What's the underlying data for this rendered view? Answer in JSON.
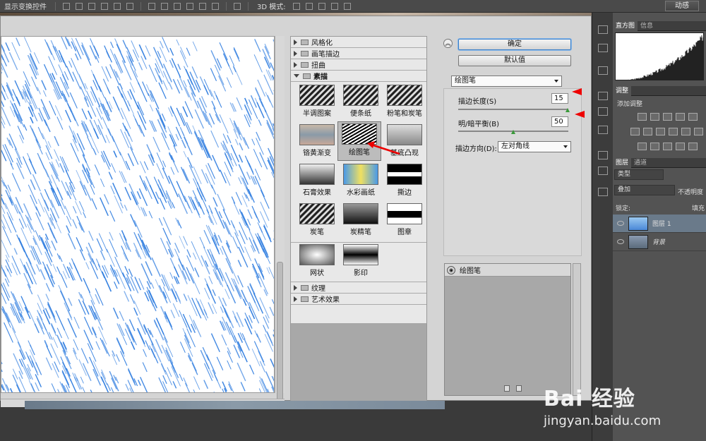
{
  "toolbar": {
    "title": "显示变换控件",
    "mode3d": "3D 模式:",
    "right_button": "动感"
  },
  "filters": {
    "categories_top": [
      "风格化",
      "画笔描边",
      "扭曲"
    ],
    "expanded_category": "素描",
    "thumbnails": [
      {
        "label": "半调图案",
        "selected": false
      },
      {
        "label": "便条纸",
        "selected": false
      },
      {
        "label": "粉笔和炭笔",
        "selected": false
      },
      {
        "label": "铬黄渐变",
        "selected": false
      },
      {
        "label": "绘图笔",
        "selected": true
      },
      {
        "label": "基底凸现",
        "selected": false
      },
      {
        "label": "石膏效果",
        "selected": false
      },
      {
        "label": "水彩画纸",
        "selected": false
      },
      {
        "label": "撕边",
        "selected": false
      },
      {
        "label": "炭笔",
        "selected": false
      },
      {
        "label": "炭精笔",
        "selected": false
      },
      {
        "label": "图章",
        "selected": false
      },
      {
        "label": "网状",
        "selected": false
      },
      {
        "label": "影印",
        "selected": false
      }
    ],
    "categories_bottom": [
      "纹理",
      "艺术效果"
    ]
  },
  "buttons": {
    "ok": "确定",
    "default": "默认值"
  },
  "settings": {
    "filter_select": "绘图笔",
    "stroke_length_label": "描边长度(S)",
    "stroke_length_value": "15",
    "balance_label": "明/暗平衡(B)",
    "balance_value": "50",
    "direction_label": "描边方向(D):",
    "direction_value": "左对角线"
  },
  "effect_layers": {
    "items": [
      "绘图笔"
    ]
  },
  "right_panel": {
    "tab_histogram": "直方图",
    "tab_info": "信息",
    "tab_adjust": "调整",
    "add_adjust": "添加调整",
    "tab_layers": "图层",
    "tab_channels": "通道",
    "kind": "类型",
    "blend_mode": "叠加",
    "opacity_label": "不透明度",
    "lock_label": "锁定:",
    "fill_label": "填充",
    "layers": [
      "图层 1",
      "背景"
    ]
  },
  "watermark": {
    "brand": "Bai 经验",
    "url": "jingyan.baidu.com"
  },
  "colors": {
    "stroke_blue": "#2f7de0",
    "arrow_red": "#e00000",
    "panel_gray": "#535353"
  }
}
